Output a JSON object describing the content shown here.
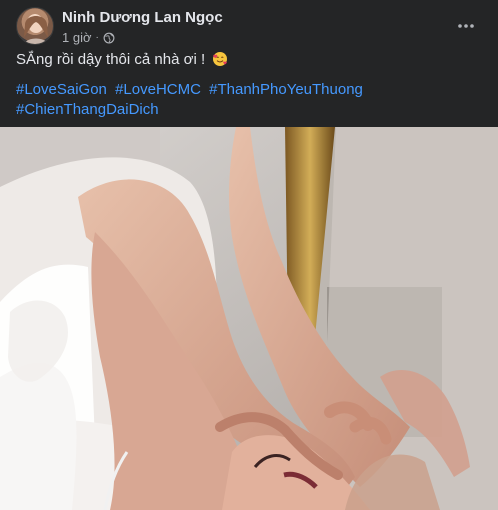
{
  "post": {
    "author": "Ninh Dương Lan Ngọc",
    "time": "1 giờ",
    "separator": "·",
    "privacy_icon": "globe-icon",
    "more_icon": "more-options-icon",
    "caption": "SẮng rồi dậy thôi cả nhà ơi !",
    "caption_emoji": "smiling-face-with-hearts-emoji",
    "hashtags": [
      "#LoveSaiGon",
      "#LoveHCMC",
      "#ThanhPhoYeuThuong",
      "#ChienThangDaiDich"
    ],
    "photo": "post-photo"
  },
  "colors": {
    "background": "#242526",
    "text_primary": "#e4e6eb",
    "text_secondary": "#b0b3b8",
    "hashtag": "#4599ff"
  }
}
